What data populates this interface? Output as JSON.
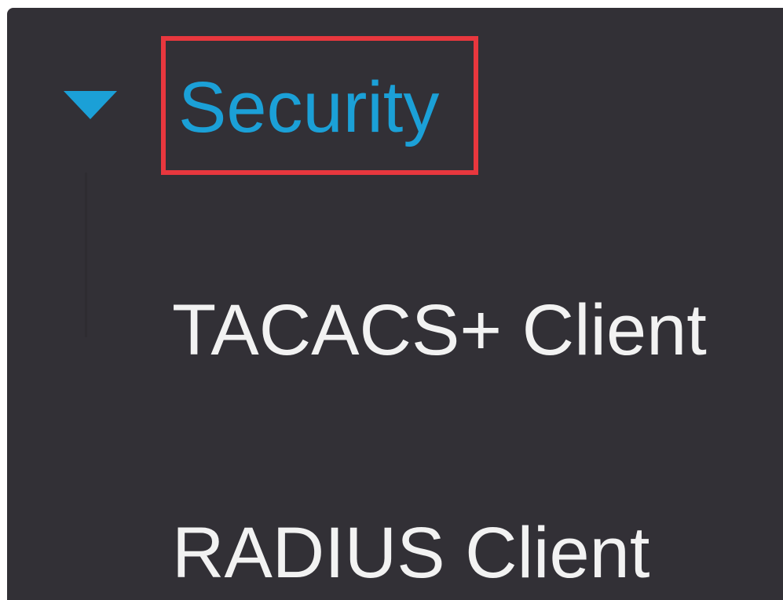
{
  "menu": {
    "section": {
      "label": "Security",
      "expanded": true,
      "highlighted": true,
      "icon": "caret-down-icon"
    },
    "items": [
      {
        "label": "TACACS+ Client"
      },
      {
        "label": "RADIUS Client"
      }
    ]
  },
  "colors": {
    "panel_background": "#323036",
    "accent": "#1ba0d7",
    "highlight_border": "#e8373e",
    "item_text": "#f2f2f2"
  }
}
